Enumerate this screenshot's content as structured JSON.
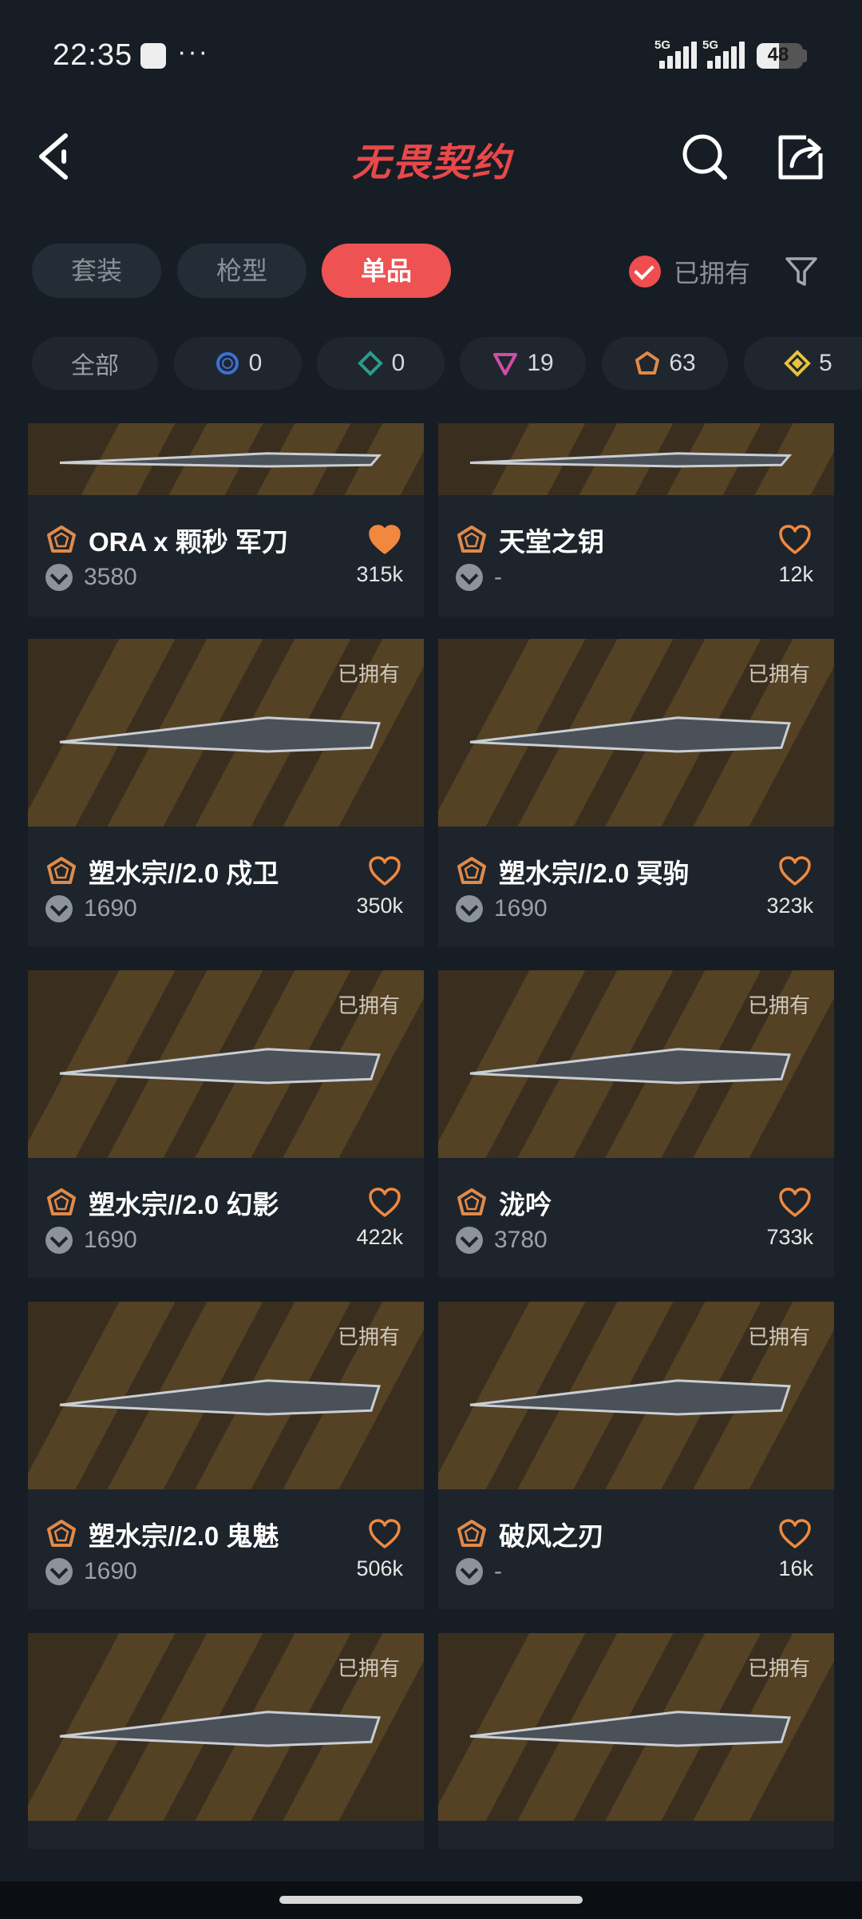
{
  "status": {
    "time": "22:35",
    "dots": "···",
    "sig1": "5G",
    "sig2": "5G",
    "battery": "48",
    "battery_level": 0.48
  },
  "header": {
    "logo": "无畏契约"
  },
  "tabs": [
    {
      "label": "套装",
      "active": false
    },
    {
      "label": "枪型",
      "active": false
    },
    {
      "label": "单品",
      "active": true
    }
  ],
  "owned_filter": {
    "label": "已拥有",
    "checked": true
  },
  "chips": [
    {
      "label": "全部",
      "count": "",
      "icon": "all"
    },
    {
      "label": "",
      "count": "0",
      "icon": "select-tier-icon",
      "color": "#3d6fd6"
    },
    {
      "label": "",
      "count": "0",
      "icon": "deluxe-tier-icon",
      "color": "#2a9c8b"
    },
    {
      "label": "",
      "count": "19",
      "icon": "premium-tier-icon",
      "color": "#d04da5"
    },
    {
      "label": "",
      "count": "63",
      "icon": "ultra-tier-icon",
      "color": "#e08a4a"
    },
    {
      "label": "",
      "count": "5",
      "icon": "exclusive-tier-icon",
      "color": "#e8c23a"
    }
  ],
  "items": [
    {
      "name": "ORA x 颗秒 军刀",
      "price": "3580",
      "likes": "315k",
      "owned": "",
      "liked": true
    },
    {
      "name": "天堂之钥",
      "price": "-",
      "likes": "12k",
      "owned": "",
      "liked": false
    },
    {
      "name": "塑水宗//2.0 戍卫",
      "price": "1690",
      "likes": "350k",
      "owned": "已拥有",
      "liked": false
    },
    {
      "name": "塑水宗//2.0 冥驹",
      "price": "1690",
      "likes": "323k",
      "owned": "已拥有",
      "liked": false
    },
    {
      "name": "塑水宗//2.0 幻影",
      "price": "1690",
      "likes": "422k",
      "owned": "已拥有",
      "liked": false
    },
    {
      "name": "泷吟",
      "price": "3780",
      "likes": "733k",
      "owned": "已拥有",
      "liked": false
    },
    {
      "name": "塑水宗//2.0 鬼魅",
      "price": "1690",
      "likes": "506k",
      "owned": "已拥有",
      "liked": false
    },
    {
      "name": "破风之刃",
      "price": "-",
      "likes": "16k",
      "owned": "已拥有",
      "liked": false
    },
    {
      "name": "",
      "price": "",
      "likes": "",
      "owned": "已拥有",
      "liked": false
    },
    {
      "name": "",
      "price": "",
      "likes": "",
      "owned": "已拥有",
      "liked": false
    }
  ],
  "colors": {
    "accent": "#ef5253",
    "tier_ultra": "#e08a4a",
    "heart": "#f0893f"
  }
}
